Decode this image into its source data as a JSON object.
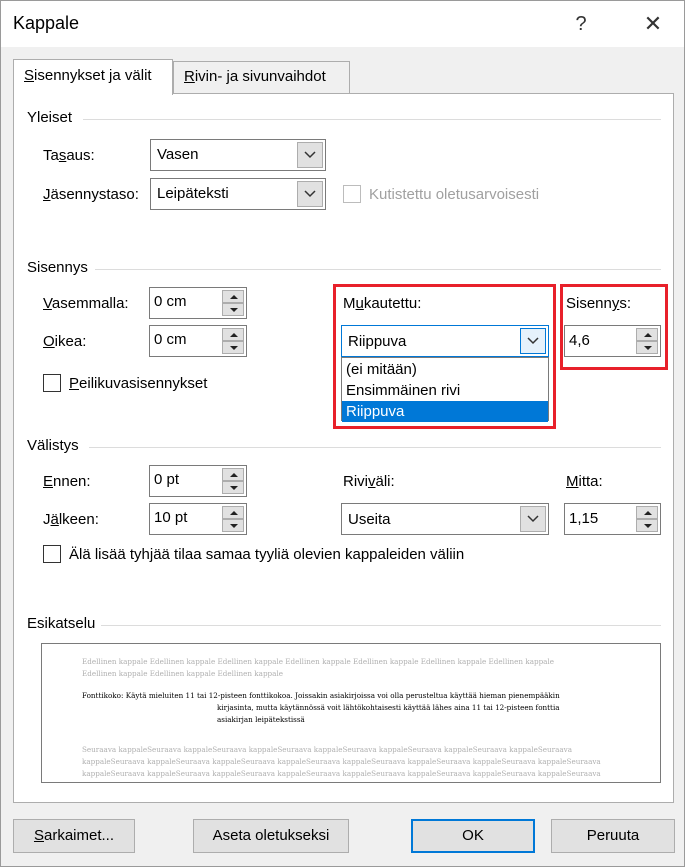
{
  "window": {
    "title": "Kappale",
    "help_glyph": "?",
    "close_glyph": "✕"
  },
  "tabs": [
    {
      "label": "Sisennykset ja välit"
    },
    {
      "label": "Rivin- ja sivunvaihdot"
    }
  ],
  "general": {
    "heading": "Yleiset",
    "alignment_label": "Tasaus:",
    "alignment_value": "Vasen",
    "outline_label": "Jäsennystaso:",
    "outline_value": "Leipäteksti",
    "collapsed_label": "Kutistettu oletusarvoisesti",
    "collapsed_checked": false
  },
  "indentation": {
    "heading": "Sisennys",
    "left_label": "Vasemmalla:",
    "left_value": "0 cm",
    "right_label": "Oikea:",
    "right_value": "0 cm",
    "mirror_label": "Peilikuvasisennykset",
    "mirror_checked": false,
    "special_label": "Mukautettu:",
    "special_value": "Riippuva",
    "special_options": [
      "(ei mitään)",
      "Ensimmäinen rivi",
      "Riippuva"
    ],
    "special_selected_index": 2,
    "by_label": "Sisennys:",
    "by_value": "4,6"
  },
  "spacing": {
    "heading": "Välistys",
    "before_label": "Ennen:",
    "before_value": "0 pt",
    "after_label": "Jälkeen:",
    "after_value": "10 pt",
    "line_spacing_label": "Riviväli:",
    "line_spacing_value": "Useita",
    "at_label": "Mitta:",
    "at_value": "1,15",
    "no_space_label": "Älä lisää tyhjää tilaa samaa tyyliä olevien kappaleiden väliin",
    "no_space_checked": false
  },
  "preview": {
    "heading": "Esikatselu",
    "previous_lines": [
      "Edellinen kappale Edellinen kappale Edellinen kappale Edellinen kappale Edellinen kappale Edellinen kappale Edellinen kappale",
      "Edellinen kappale Edellinen kappale Edellinen kappale"
    ],
    "sample_lines": [
      "Fonttikoko: Käytä mieluiten 11 tai 12-pisteen fonttikokoa. Joissakin asiakirjoissa voi olla perusteltua käyttää hieman pienempääkin",
      "kirjasinta, mutta käytännössä voit lähtökohtaisesti käyttää lähes aina 11 tai 12-pisteen fonttia",
      "asiakirjan leipätekstissä"
    ],
    "following_lines": [
      "Seuraava kappaleSeuraava kappaleSeuraava kappaleSeuraava kappaleSeuraava kappaleSeuraava kappaleSeuraava kappaleSeuraava",
      "kappaleSeuraava kappaleSeuraava kappaleSeuraava kappaleSeuraava kappaleSeuraava kappaleSeuraava kappaleSeuraava kappaleSeuraava",
      "kappaleSeuraava kappaleSeuraava kappaleSeuraava kappaleSeuraava kappaleSeuraava kappaleSeuraava kappaleSeuraava kappaleSeuraava"
    ]
  },
  "buttons": {
    "tabs": "Sarkaimet...",
    "set_default": "Aseta oletukseksi",
    "ok": "OK",
    "cancel": "Peruuta"
  },
  "colors": {
    "highlight": "#e8202a",
    "selection": "#0078d7"
  }
}
